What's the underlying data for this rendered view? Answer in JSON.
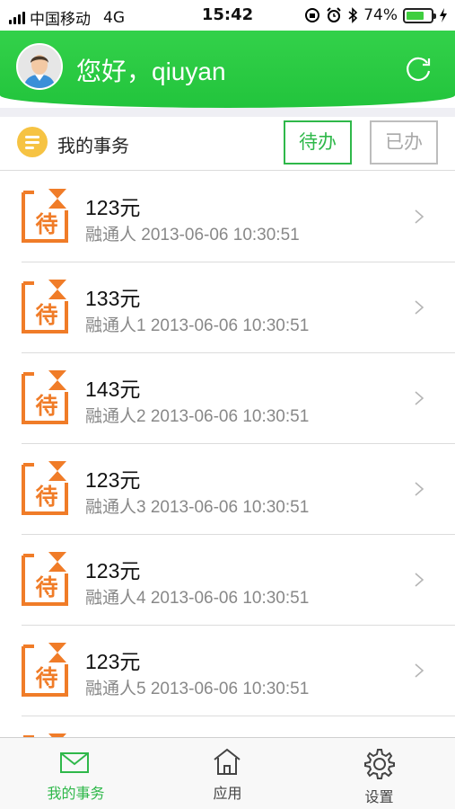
{
  "status_bar": {
    "carrier": "中国移动",
    "network": "4G",
    "time": "15:42",
    "battery": "74%",
    "battery_level": 0.74
  },
  "header": {
    "greeting": "您好，qiuyan"
  },
  "tasks": {
    "title": "我的事务",
    "tabs": [
      {
        "label": "待办",
        "active": true
      },
      {
        "label": "已办",
        "active": false
      }
    ],
    "items": [
      {
        "badge": "待",
        "amount": "123元",
        "meta": "融通人 2013-06-06 10:30:51"
      },
      {
        "badge": "待",
        "amount": "133元",
        "meta": "融通人1 2013-06-06 10:30:51"
      },
      {
        "badge": "待",
        "amount": "143元",
        "meta": "融通人2 2013-06-06 10:30:51"
      },
      {
        "badge": "待",
        "amount": "123元",
        "meta": "融通人3 2013-06-06 10:30:51"
      },
      {
        "badge": "待",
        "amount": "123元",
        "meta": "融通人4 2013-06-06 10:30:51"
      },
      {
        "badge": "待",
        "amount": "123元",
        "meta": "融通人5 2013-06-06 10:30:51"
      },
      {
        "badge": "待",
        "amount": "",
        "meta": ""
      }
    ]
  },
  "tabbar": {
    "items": [
      {
        "label": "我的事务",
        "icon": "mail-icon",
        "active": true
      },
      {
        "label": "应用",
        "icon": "home-icon",
        "active": false
      },
      {
        "label": "设置",
        "icon": "gear-icon",
        "active": false
      }
    ]
  },
  "colors": {
    "brand_green": "#2fb84a",
    "header_green": "#22c43c",
    "badge_orange": "#f07c28",
    "tasks_icon_yellow": "#f6c343"
  }
}
